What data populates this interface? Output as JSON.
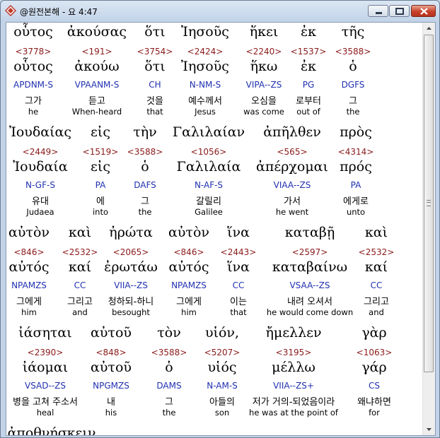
{
  "window": {
    "title": "@원전본해 - 요 4:47"
  },
  "verse_words": [
    {
      "greek": "οὗτος",
      "strongs": "<3778>",
      "lemma": "οὗτος",
      "parse": "APDNM-S",
      "korean": "그가",
      "english": "he"
    },
    {
      "greek": "ἀκούσας",
      "strongs": "<191>",
      "lemma": "ἀκούω",
      "parse": "VPAANM-S",
      "korean": "듣고",
      "english": "When-heard"
    },
    {
      "greek": "ὅτι",
      "strongs": "<3754>",
      "lemma": "ὅτι",
      "parse": "CH",
      "korean": "것을",
      "english": "that"
    },
    {
      "greek": "Ἰησοῦς",
      "strongs": "<2424>",
      "lemma": "Ἰησοῦς",
      "parse": "N-NM-S",
      "korean": "예수께서",
      "english": "Jesus"
    },
    {
      "greek": "ἥκει",
      "strongs": "<2240>",
      "lemma": "ἥκω",
      "parse": "VIPA--ZS",
      "korean": "오심을",
      "english": "was come"
    },
    {
      "greek": "ἐκ",
      "strongs": "<1537>",
      "lemma": "ἐκ",
      "parse": "PG",
      "korean": "로부터",
      "english": "out of"
    },
    {
      "greek": "τῆς",
      "strongs": "<3588>",
      "lemma": "ὁ",
      "parse": "DGFS",
      "korean": "그",
      "english": "the"
    },
    {
      "greek": "Ἰουδαίας",
      "strongs": "<2449>",
      "lemma": "Ἰουδαία",
      "parse": "N-GF-S",
      "korean": "유대",
      "english": "Judaea"
    },
    {
      "greek": "εἰς",
      "strongs": "<1519>",
      "lemma": "εἰς",
      "parse": "PA",
      "korean": "에",
      "english": "into"
    },
    {
      "greek": "τὴν",
      "strongs": "<3588>",
      "lemma": "ὁ",
      "parse": "DAFS",
      "korean": "그",
      "english": "the"
    },
    {
      "greek": "Γαλιλαίαν",
      "strongs": "<1056>",
      "lemma": "Γαλιλαία",
      "parse": "N-AF-S",
      "korean": "갈릴리",
      "english": "Galilee"
    },
    {
      "greek": "ἀπῆλθεν",
      "strongs": "<565>",
      "lemma": "ἀπέρχομαι",
      "parse": "VIAA--ZS",
      "korean": "가서",
      "english": "he went"
    },
    {
      "greek": "πρὸς",
      "strongs": "<4314>",
      "lemma": "πρός",
      "parse": "PA",
      "korean": "에게로",
      "english": "unto"
    },
    {
      "greek": "αὐτὸν",
      "strongs": "<846>",
      "lemma": "αὐτός",
      "parse": "NPAMZS",
      "korean": "그에게",
      "english": "him"
    },
    {
      "greek": "καὶ",
      "strongs": "<2532>",
      "lemma": "καί",
      "parse": "CC",
      "korean": "그리고",
      "english": "and"
    },
    {
      "greek": "ἠρώτα",
      "strongs": "<2065>",
      "lemma": "ἐρωτάω",
      "parse": "VIIA--ZS",
      "korean": "청하되-하니",
      "english": "besought"
    },
    {
      "greek": "αὐτὸν",
      "strongs": "<846>",
      "lemma": "αὐτός",
      "parse": "NPAMZS",
      "korean": "그에게",
      "english": "him"
    },
    {
      "greek": "ἵνα",
      "strongs": "<2443>",
      "lemma": "ἵνα",
      "parse": "CC",
      "korean": "이는",
      "english": "that"
    },
    {
      "greek": "καταβῇ",
      "strongs": "<2597>",
      "lemma": "καταβαίνω",
      "parse": "VSAA--ZS",
      "korean": "내려 오셔서",
      "english": "he would come down"
    },
    {
      "greek": "καὶ",
      "strongs": "<2532>",
      "lemma": "καί",
      "parse": "CC",
      "korean": "그리고",
      "english": "and"
    },
    {
      "greek": "ἰάσηται",
      "strongs": "<2390>",
      "lemma": "ἰάομαι",
      "parse": "VSAD--ZS",
      "korean": "병을 고쳐 주소서",
      "english": "heal"
    },
    {
      "greek": "αὐτοῦ",
      "strongs": "<848>",
      "lemma": "αὐτοῦ",
      "parse": "NPGMZS",
      "korean": "내",
      "english": "his"
    },
    {
      "greek": "τὸν",
      "strongs": "<3588>",
      "lemma": "ὁ",
      "parse": "DAMS",
      "korean": "그",
      "english": "the"
    },
    {
      "greek": "υἱόν,",
      "strongs": "<5207>",
      "lemma": "υἱός",
      "parse": "N-AM-S",
      "korean": "아들의",
      "english": "son"
    },
    {
      "greek": "ἤμελλεν",
      "strongs": "<3195>",
      "lemma": "μέλλω",
      "parse": "VIIA--ZS+",
      "korean": "저가 거의-되었음이라",
      "english": "he was at the point of"
    },
    {
      "greek": "γὰρ",
      "strongs": "<1063>",
      "lemma": "γάρ",
      "parse": "CS",
      "korean": "왜냐하면",
      "english": "for"
    },
    {
      "greek": "ἀποθνῄσκειν",
      "strongs": "",
      "lemma": "",
      "parse": "",
      "korean": "",
      "english": ""
    }
  ],
  "colors": {
    "greek": "#000000",
    "strongs": "#8b1a1a",
    "parse": "#2030b0",
    "korean": "#000000",
    "english": "#000000"
  }
}
